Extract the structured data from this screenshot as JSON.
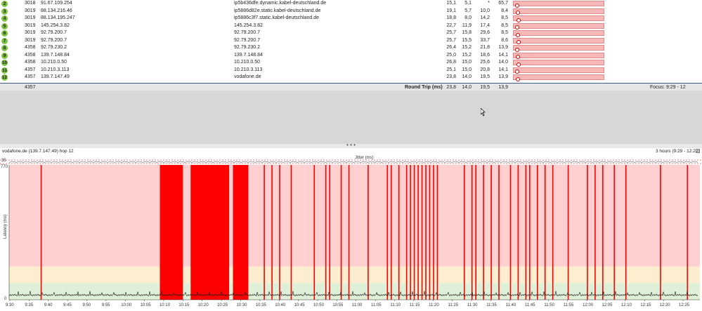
{
  "hops": [
    {
      "num": "2",
      "asn": "3018",
      "ip": "91.67.109.254",
      "name": "ip5b436dfe.dynamic.kabel-deutschland.de",
      "avg": "15,1",
      "min": "5,1",
      "cur": "*",
      "max": "65,7"
    },
    {
      "num": "3",
      "asn": "3019",
      "ip": "88.134.216.46",
      "name": "ip5886d82e.static.kabel-deutschland.de",
      "avg": "19,1",
      "min": "5,7",
      "cur": "10,0",
      "max": "8,4"
    },
    {
      "num": "4",
      "asn": "3019",
      "ip": "88.134.195.247",
      "name": "ip5886c3f7.static.kabel-deutschland.de",
      "avg": "18,8",
      "min": "8,0",
      "cur": "14,2",
      "max": "8,5"
    },
    {
      "num": "5",
      "asn": "3019",
      "ip": "145.254.3.82",
      "name": "145.254.3.82",
      "avg": "22,7",
      "min": "11,9",
      "cur": "17,4",
      "max": "8,5"
    },
    {
      "num": "6",
      "asn": "3019",
      "ip": "92.79.200.7",
      "name": "92.79.200.7",
      "avg": "25,7",
      "min": "15,8",
      "cur": "29,6",
      "max": "8,5"
    },
    {
      "num": "7",
      "asn": "3019",
      "ip": "92.79.200.7",
      "name": "92.79.200.7",
      "avg": "25,7",
      "min": "15,5",
      "cur": "33,7",
      "max": "8,6"
    },
    {
      "num": "8",
      "asn": "4358",
      "ip": "92.79.230.2",
      "name": "92.79.230.2",
      "avg": "26,4",
      "min": "15,2",
      "cur": "21,8",
      "max": "13,9"
    },
    {
      "num": "9",
      "asn": "4358",
      "ip": "139.7.148.84",
      "name": "139.7.148.84",
      "avg": "25,0",
      "min": "15,2",
      "cur": "18,6",
      "max": "14,1"
    },
    {
      "num": "10",
      "asn": "4358",
      "ip": "10.210.0.50",
      "name": "10.210.0.50",
      "avg": "26,8",
      "min": "15,0",
      "cur": "25,6",
      "max": "14,0"
    },
    {
      "num": "11",
      "asn": "4357",
      "ip": "10.210.3.113",
      "name": "10.210.3.113",
      "avg": "25,1",
      "min": "15,0",
      "cur": "20,8",
      "max": "14,1"
    },
    {
      "num": "12",
      "asn": "4357",
      "ip": "139.7.147.49",
      "name": "vodafone.de",
      "avg": "23,8",
      "min": "14,0",
      "cur": "19,5",
      "max": "13,9"
    }
  ],
  "summary": {
    "asn": "4357",
    "label": "Round Trip (ms)",
    "avg": "23,8",
    "min": "14,0",
    "cur": "19,5",
    "max": "13,9",
    "focus": "Focus: 9:29 - 12"
  },
  "splitter": {
    "grip": "• • •"
  },
  "graph": {
    "title": "vodafone.de (139.7.147.49) hop 12",
    "range": "3 hours (9:29 - 12:29)",
    "jitter_label": "Jitter (ms)",
    "jitter_max": "35",
    "ymax": "770",
    "ymin": "0",
    "ylabel": "Latency (ms)"
  },
  "chart_data": {
    "type": "area",
    "xlabel": "",
    "ylabel": "Latency (ms)",
    "ylim": [
      0,
      770
    ],
    "x_ticks": [
      "9:30",
      "9:35",
      "9:40",
      "9:45",
      "9:50",
      "9:55",
      "10:00",
      "10:05",
      "10:10",
      "10:15",
      "10:20",
      "10:25",
      "10:30",
      "10:35",
      "10:40",
      "10:45",
      "10:50",
      "10:55",
      "11:00",
      "11:05",
      "11:10",
      "11:15",
      "11:20",
      "11:25",
      "11:30",
      "11:35",
      "11:40",
      "11:45",
      "11:50",
      "11:55",
      "12:00",
      "12:05",
      "12:10",
      "12:15",
      "12:20",
      "12:25"
    ],
    "loss_blocks": [
      [
        10.09,
        10.15
      ],
      [
        10.17,
        10.27
      ],
      [
        10.28,
        10.32
      ]
    ],
    "loss_spikes": [
      9.38,
      10.26,
      10.36,
      10.38,
      10.4,
      10.43,
      10.49,
      10.52,
      10.53,
      10.56,
      10.58,
      11.03,
      11.08,
      11.09,
      11.11,
      11.13,
      11.14,
      11.15,
      11.16,
      11.17,
      11.18,
      11.19,
      11.2,
      11.21,
      11.28,
      11.3,
      11.31,
      11.33,
      11.35,
      11.37,
      11.4,
      11.42,
      11.44,
      11.45,
      11.47,
      11.49,
      11.51,
      11.55,
      12.0,
      12.02,
      12.04,
      12.07,
      12.1,
      12.19,
      12.26
    ],
    "colors": {
      "bad": "#ffd0cf",
      "warn": "#fdeecf",
      "good": "#dff0d8",
      "loss": "#ff0000",
      "line": "#1b1b1b"
    }
  }
}
